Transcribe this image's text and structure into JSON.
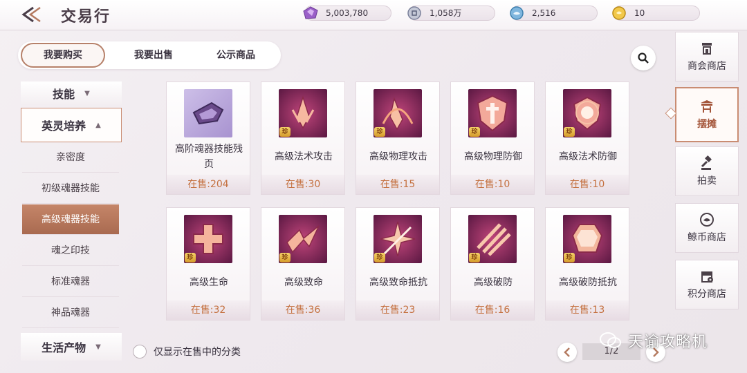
{
  "header": {
    "title": "交易行",
    "currencies": [
      {
        "icon": "crystal-currency-icon",
        "value": "5,003,780"
      },
      {
        "icon": "silver-coin-icon",
        "value": "1,058万"
      },
      {
        "icon": "whale-coin-icon",
        "value": "2,516"
      },
      {
        "icon": "gold-coin-icon",
        "value": "10"
      }
    ]
  },
  "tabs": [
    {
      "label": "我要购买",
      "active": true
    },
    {
      "label": "我要出售",
      "active": false
    },
    {
      "label": "公示商品",
      "active": false
    }
  ],
  "categories": {
    "skill": {
      "label": "技能",
      "chevron": "chevron-down-icon"
    },
    "hero": {
      "label": "英灵培养",
      "chevron": "chevron-up-icon"
    },
    "sub_items": [
      {
        "label": "亲密度",
        "active": false
      },
      {
        "label": "初级魂器技能",
        "active": false
      },
      {
        "label": "高级魂器技能",
        "active": true
      },
      {
        "label": "魂之印技",
        "active": false
      },
      {
        "label": "标准魂器",
        "active": false
      },
      {
        "label": "神品魂器",
        "active": false
      }
    ],
    "life": {
      "label": "生活产物",
      "chevron": "chevron-down-icon"
    }
  },
  "items": [
    {
      "name": "高阶魂器技能残页",
      "stock": "在售:204",
      "icon": "skill-page-icon",
      "zhen": false
    },
    {
      "name": "高级法术攻击",
      "stock": "在售:30",
      "icon": "magic-attack-icon",
      "zhen": true
    },
    {
      "name": "高级物理攻击",
      "stock": "在售:15",
      "icon": "physical-attack-icon",
      "zhen": true
    },
    {
      "name": "高级物理防御",
      "stock": "在售:10",
      "icon": "physical-defense-icon",
      "zhen": true
    },
    {
      "name": "高级法术防御",
      "stock": "在售:10",
      "icon": "magic-defense-icon",
      "zhen": true
    },
    {
      "name": "高级生命",
      "stock": "在售:32",
      "icon": "health-icon",
      "zhen": true
    },
    {
      "name": "高级致命",
      "stock": "在售:36",
      "icon": "critical-icon",
      "zhen": true
    },
    {
      "name": "高级致命抵抗",
      "stock": "在售:23",
      "icon": "critical-resist-icon",
      "zhen": true
    },
    {
      "name": "高级破防",
      "stock": "在售:16",
      "icon": "armor-break-icon",
      "zhen": true
    },
    {
      "name": "高级破防抵抗",
      "stock": "在售:13",
      "icon": "armor-break-resist-icon",
      "zhen": true
    }
  ],
  "zhen_label": "珍",
  "filter": {
    "label": "仅显示在售中的分类",
    "checked": false
  },
  "pager": {
    "current": "1/2"
  },
  "right_nav": [
    {
      "label": "商会商店",
      "icon": "guild-shop-icon",
      "active": false
    },
    {
      "label": "摆摊",
      "icon": "stall-icon",
      "active": true
    },
    {
      "label": "拍卖",
      "icon": "auction-hammer-icon",
      "active": false
    },
    {
      "label": "鲸币商店",
      "icon": "whale-coin-shop-icon",
      "active": false
    },
    {
      "label": "积分商店",
      "icon": "points-shop-icon",
      "active": false
    }
  ],
  "watermark": "天谕攻略机",
  "colors": {
    "accent": "#c98c72",
    "active_tab": "#b68069",
    "stock_text": "#c4703f"
  }
}
